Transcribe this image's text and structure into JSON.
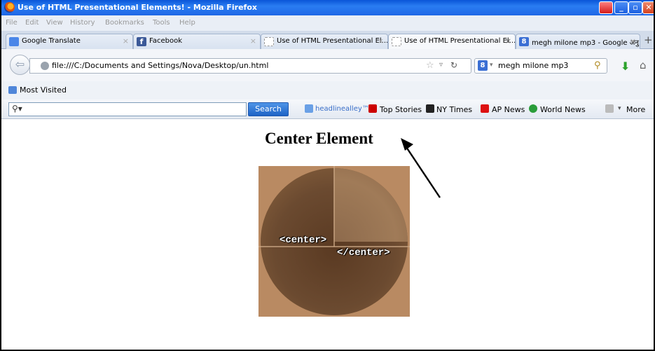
{
  "window": {
    "title": "Use of HTML Presentational Elements! - Mozilla Firefox"
  },
  "menu": [
    "File",
    "Edit",
    "View",
    "History",
    "Bookmarks",
    "Tools",
    "Help"
  ],
  "tabs": [
    {
      "label": "Google Translate",
      "icon": "google-translate-icon",
      "active": false
    },
    {
      "label": "Facebook",
      "icon": "facebook-icon",
      "active": false
    },
    {
      "label": "Use of HTML Presentational El...",
      "icon": "blank-page-icon",
      "active": false
    },
    {
      "label": "Use of HTML Presentational El...",
      "icon": "blank-page-icon",
      "active": true
    },
    {
      "label": "megh milone mp3 - Google अनु...",
      "icon": "google-icon",
      "active": false
    }
  ],
  "new_tab": "+",
  "nav": {
    "url": "file:///C:/Documents and Settings/Nova/Desktop/un.html",
    "search_query": "megh milone mp3"
  },
  "bookmarks": {
    "most_visited": "Most Visited"
  },
  "toolbar": {
    "search_button": "Search",
    "links": [
      {
        "label": "headlinealley™",
        "icon": "headlinealley-icon"
      },
      {
        "label": "Top Stories",
        "icon": "cnn-icon"
      },
      {
        "label": "NY Times",
        "icon": "nytimes-icon"
      },
      {
        "label": "AP News",
        "icon": "ap-icon"
      },
      {
        "label": "World News",
        "icon": "globe-icon"
      }
    ],
    "more": "More"
  },
  "page": {
    "heading": "Center Element",
    "open_tag": "<center>",
    "close_tag": "</center>"
  }
}
